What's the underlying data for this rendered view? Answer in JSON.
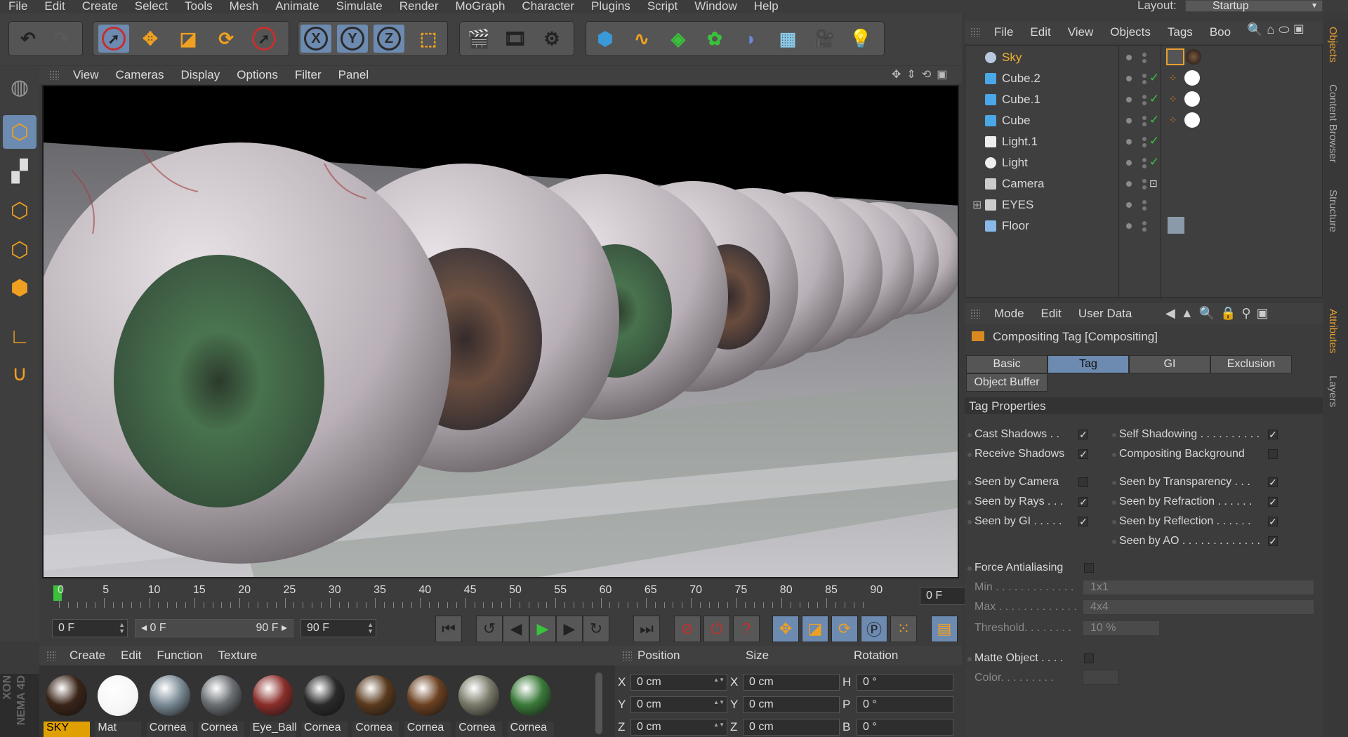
{
  "menu": [
    "File",
    "Edit",
    "Create",
    "Select",
    "Tools",
    "Mesh",
    "Animate",
    "Simulate",
    "Render",
    "MoGraph",
    "Character",
    "Plugins",
    "Script",
    "Window",
    "Help"
  ],
  "layout": {
    "label": "Layout:",
    "value": "Startup"
  },
  "toolbar": {
    "undo": "undo-icon",
    "redo": "redo-icon",
    "axis_x": "X",
    "axis_y": "Y",
    "axis_z": "Z"
  },
  "viewport": {
    "menu": [
      "View",
      "Cameras",
      "Display",
      "Options",
      "Filter",
      "Panel"
    ]
  },
  "timeline": {
    "ticks": [
      "0",
      "5",
      "10",
      "15",
      "20",
      "25",
      "30",
      "35",
      "40",
      "45",
      "50",
      "55",
      "60",
      "65",
      "70",
      "75",
      "80",
      "85",
      "90"
    ],
    "current_frame": "0 F"
  },
  "transport": {
    "start": "0 F",
    "range_start": "◂ 0 F",
    "range_end": "90 F ▸",
    "end": "90 F"
  },
  "materials": {
    "menu": [
      "Create",
      "Edit",
      "Function",
      "Texture"
    ],
    "items": [
      {
        "name": "SKY",
        "color": "#3a2418",
        "selected": true
      },
      {
        "name": "Mat",
        "color": "#ffffff"
      },
      {
        "name": "Cornea",
        "color": "#7a8a95"
      },
      {
        "name": "Cornea",
        "color": "#6a6e72"
      },
      {
        "name": "Eye_Ball",
        "color": "#8a2e2a"
      },
      {
        "name": "Cornea",
        "color": "#2a2a2a"
      },
      {
        "name": "Cornea",
        "color": "#5a3a1e"
      },
      {
        "name": "Cornea",
        "color": "#6b4020"
      },
      {
        "name": "Cornea",
        "color": "#7a7a6a"
      },
      {
        "name": "Cornea",
        "color": "#3a7a3a"
      }
    ],
    "brand_lines": [
      "XON",
      "NEMA 4D"
    ]
  },
  "coordinates": {
    "headers": [
      "Position",
      "Size",
      "Rotation"
    ],
    "rows": [
      {
        "a": "X",
        "pos": "0 cm",
        "b": "X",
        "size": "0 cm",
        "c": "H",
        "rot": "0 °"
      },
      {
        "a": "Y",
        "pos": "0 cm",
        "b": "Y",
        "size": "0 cm",
        "c": "P",
        "rot": "0 °"
      },
      {
        "a": "Z",
        "pos": "0 cm",
        "b": "Z",
        "size": "0 cm",
        "c": "B",
        "rot": "0 °"
      }
    ]
  },
  "objects": {
    "menu": [
      "File",
      "Edit",
      "View",
      "Objects",
      "Tags",
      "Boo"
    ],
    "items": [
      {
        "name": "Sky",
        "icon": "sky-icon",
        "highlight": true,
        "check": false
      },
      {
        "name": "Cube.2",
        "icon": "cube-icon",
        "check": true
      },
      {
        "name": "Cube.1",
        "icon": "cube-icon",
        "check": true
      },
      {
        "name": "Cube",
        "icon": "cube-icon",
        "check": true
      },
      {
        "name": "Light.1",
        "icon": "area-light-icon",
        "check": true
      },
      {
        "name": "Light",
        "icon": "light-icon",
        "check": true
      },
      {
        "name": "Camera",
        "icon": "camera-icon",
        "check": false
      },
      {
        "name": "EYES",
        "icon": "null-icon",
        "check": false
      },
      {
        "name": "Floor",
        "icon": "floor-icon",
        "check": false
      }
    ]
  },
  "side_tabs": [
    "Objects",
    "Content Browser",
    "Structure",
    "Attributes",
    "Layers"
  ],
  "attributes": {
    "menu": [
      "Mode",
      "Edit",
      "User Data"
    ],
    "title": "Compositing Tag [Compositing]",
    "tabs": [
      "Basic",
      "Tag",
      "GI",
      "Exclusion",
      "Object Buffer"
    ],
    "active_tab": "Tag",
    "section": "Tag Properties",
    "left_props": [
      {
        "label": "Cast Shadows . .",
        "checked": true
      },
      {
        "label": "Receive Shadows",
        "checked": true
      },
      {
        "label": "Seen by Camera",
        "checked": false
      },
      {
        "label": "Seen by Rays . . .",
        "checked": true
      },
      {
        "label": "Seen by GI . . . . .",
        "checked": true
      }
    ],
    "right_props": [
      {
        "label": "Self Shadowing . . . . . . . . . .",
        "checked": true
      },
      {
        "label": "Compositing Background",
        "checked": false
      },
      {
        "label": "Seen by Transparency . . .",
        "checked": true
      },
      {
        "label": "Seen by Refraction . . . . . .",
        "checked": true
      },
      {
        "label": "Seen by Reflection . . . . . .",
        "checked": true
      },
      {
        "label": "Seen by AO . . . . . . . . . . . . .",
        "checked": true
      }
    ],
    "force_aa": "Force Antialiasing",
    "min_label": "Min . . . . . . . . . . . . .",
    "min_value": "1x1",
    "max_label": "Max . . . . . . . . . . . . .",
    "max_value": "4x4",
    "threshold_label": "Threshold. . . . . . . .",
    "threshold_value": "10 %",
    "matte": "Matte Object . . . .",
    "color_label": "Color. . . . . . . . ."
  },
  "colors": {
    "accent": "#6d8ab0",
    "highlight": "#f0b030",
    "check": "#3ec23e"
  }
}
